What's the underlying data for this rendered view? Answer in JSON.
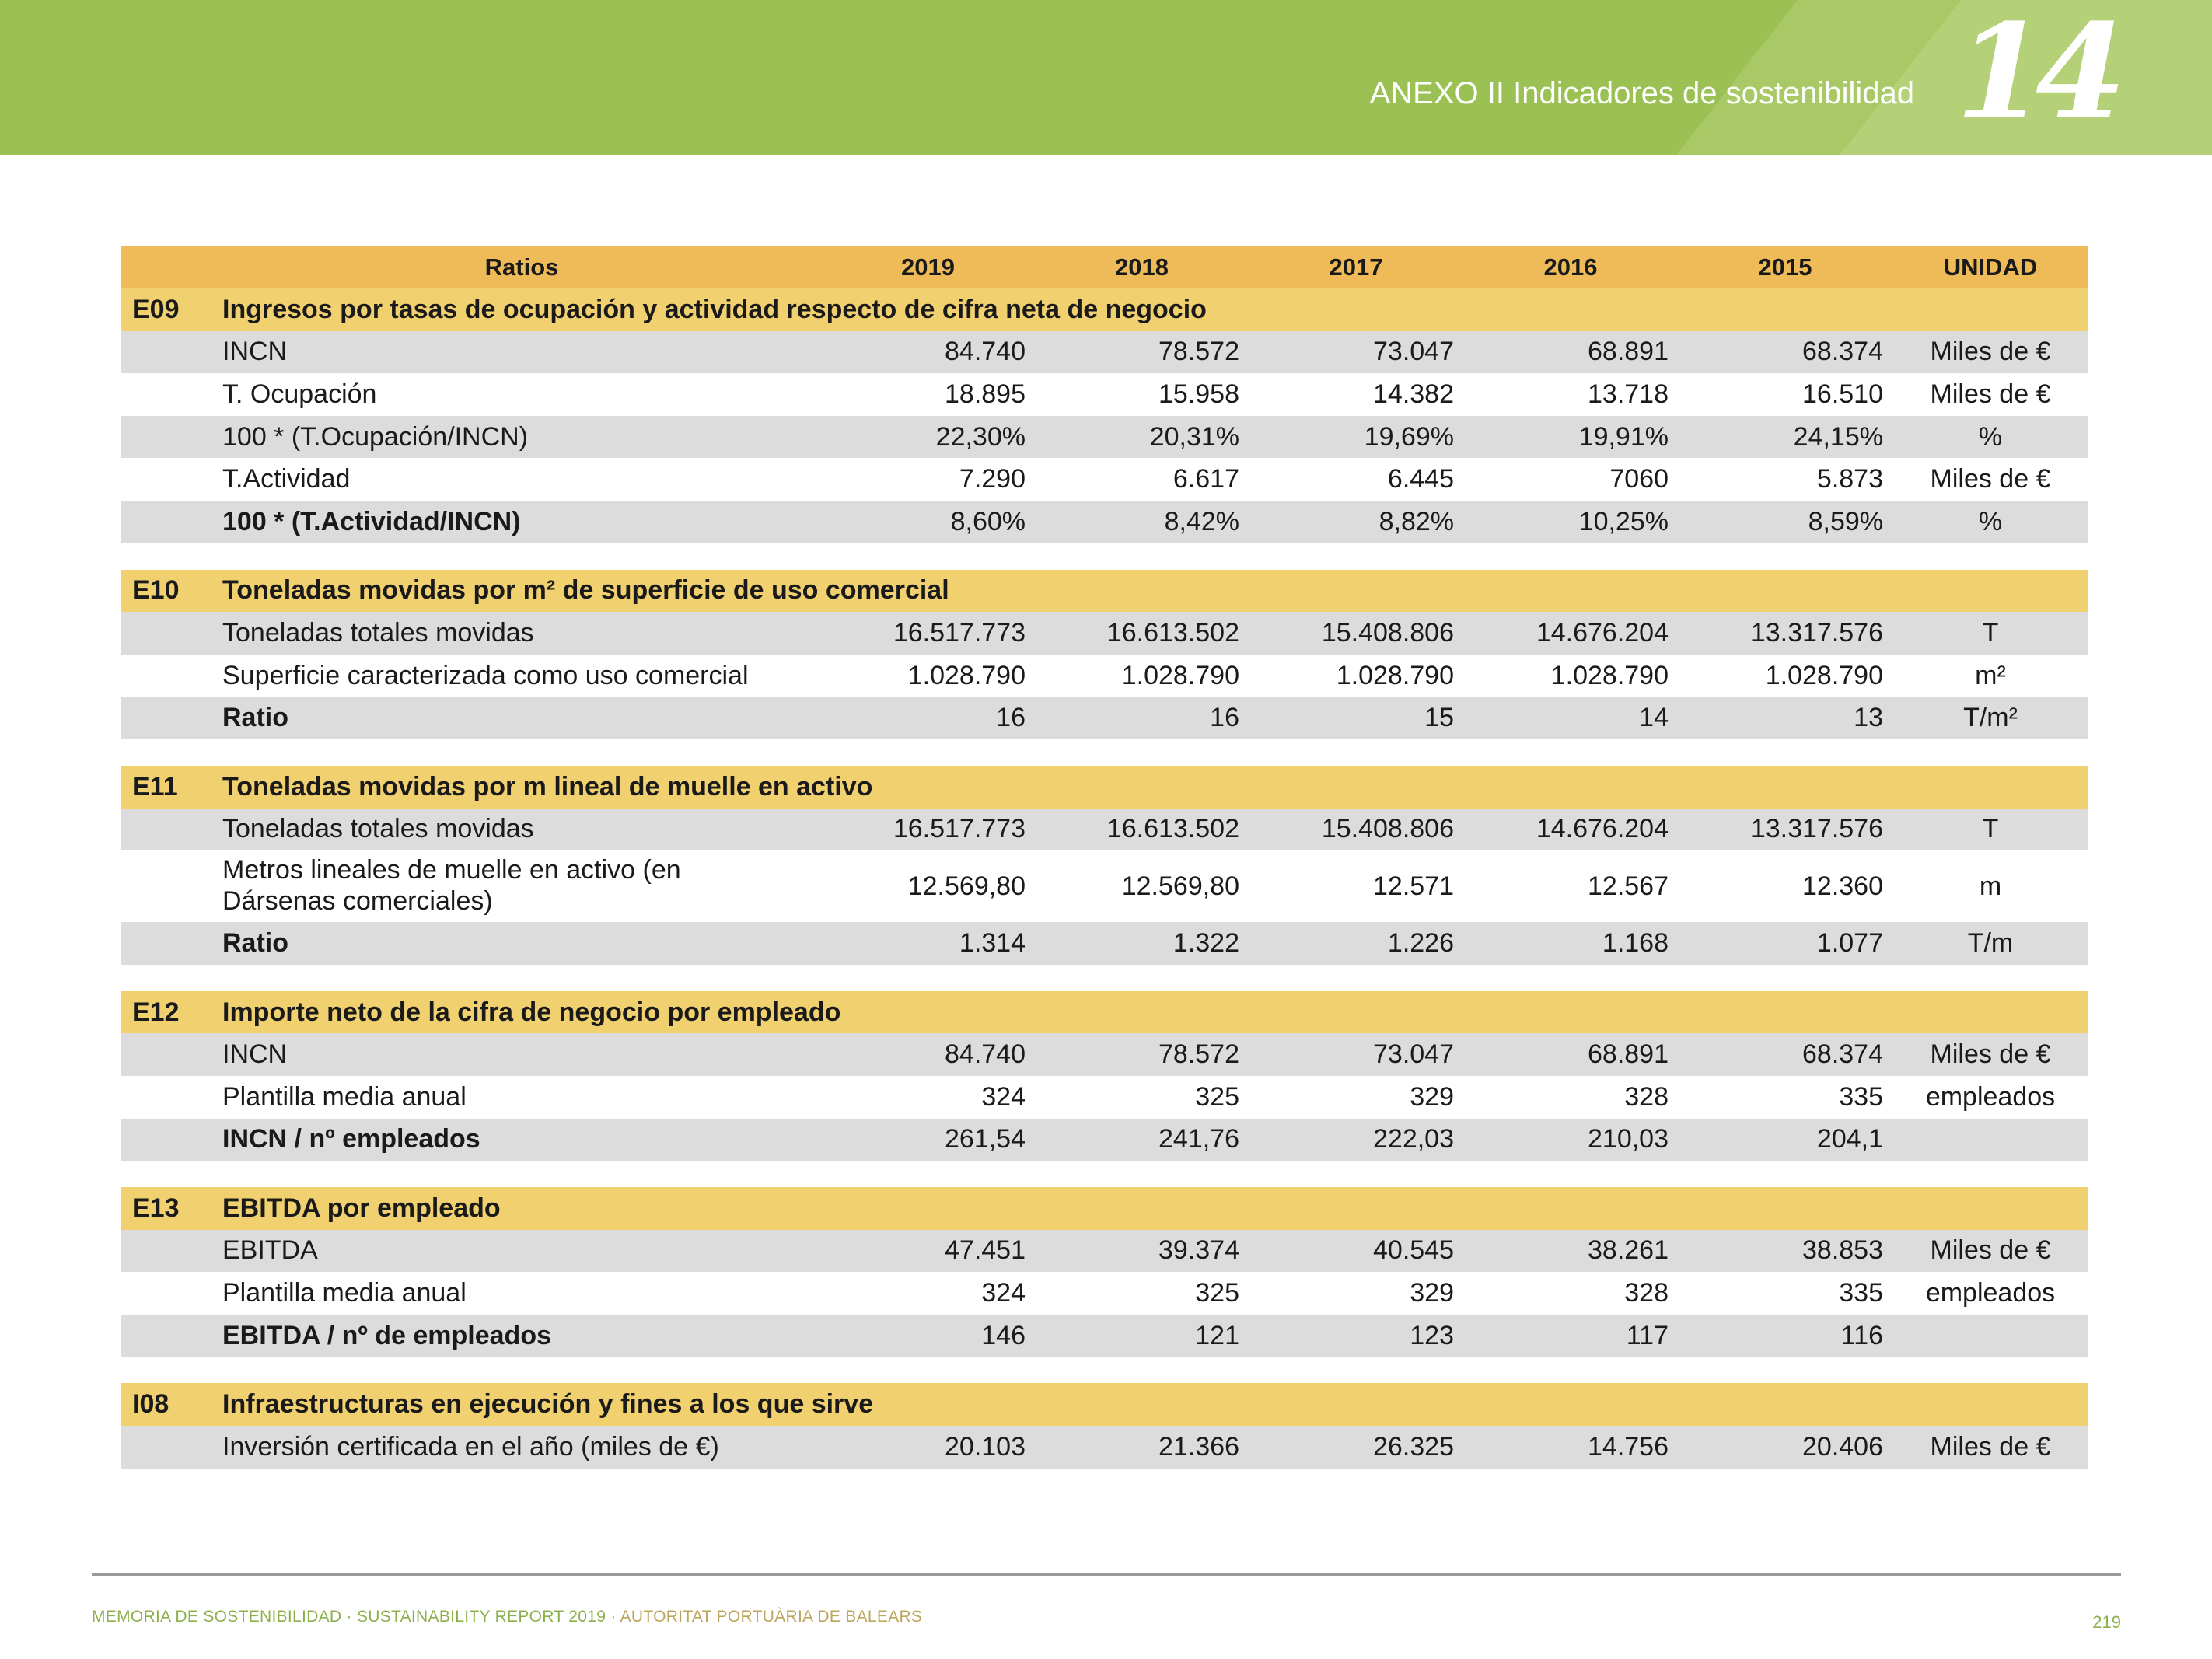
{
  "header": {
    "title": "ANEXO II Indicadores de sostenibilidad",
    "chapter_number": "14",
    "colors": {
      "band": "#9bc155",
      "text": "#ffffff"
    }
  },
  "table": {
    "columns": [
      "Ratios",
      "2019",
      "2018",
      "2017",
      "2016",
      "2015",
      "UNIDAD"
    ],
    "colors": {
      "column_header": "#eebb58",
      "section_header": "#f0d06f",
      "shaded_row": "#dcdcdc"
    },
    "sections": [
      {
        "code": "E09",
        "title": "Ingresos por tasas de ocupación y actividad respecto de cifra neta de negocio",
        "rows": [
          {
            "label": "INCN",
            "values": [
              "84.740",
              "78.572",
              "73.047",
              "68.891",
              "68.374"
            ],
            "unit": "Miles de €"
          },
          {
            "label": "T. Ocupación",
            "values": [
              "18.895",
              "15.958",
              "14.382",
              "13.718",
              "16.510"
            ],
            "unit": "Miles de €"
          },
          {
            "label": "100 * (T.Ocupación/INCN)",
            "values": [
              "22,30%",
              "20,31%",
              "19,69%",
              "19,91%",
              "24,15%"
            ],
            "unit": "%"
          },
          {
            "label": "T.Actividad",
            "values": [
              "7.290",
              "6.617",
              "6.445",
              "7060",
              "5.873"
            ],
            "unit": "Miles de €"
          },
          {
            "label": "100 * (T.Actividad/INCN)",
            "values": [
              "8,60%",
              "8,42%",
              "8,82%",
              "10,25%",
              "8,59%"
            ],
            "unit": "%"
          }
        ]
      },
      {
        "code": "E10",
        "title": "Toneladas movidas por m² de superficie de uso comercial",
        "rows": [
          {
            "label": "Toneladas totales movidas",
            "values": [
              "16.517.773",
              "16.613.502",
              "15.408.806",
              "14.676.204",
              "13.317.576"
            ],
            "unit": "T"
          },
          {
            "label": "Superficie caracterizada como uso comercial",
            "values": [
              "1.028.790",
              "1.028.790",
              "1.028.790",
              "1.028.790",
              "1.028.790"
            ],
            "unit": "m²"
          },
          {
            "label": "Ratio",
            "values": [
              "16",
              "16",
              "15",
              "14",
              "13"
            ],
            "unit": "T/m²"
          }
        ]
      },
      {
        "code": "E11",
        "title": "Toneladas movidas por m lineal de muelle en activo",
        "rows": [
          {
            "label": "Toneladas totales movidas",
            "values": [
              "16.517.773",
              "16.613.502",
              "15.408.806",
              "14.676.204",
              "13.317.576"
            ],
            "unit": "T"
          },
          {
            "label": "Metros lineales de muelle en activo (en Dársenas comerciales)",
            "values": [
              "12.569,80",
              "12.569,80",
              "12.571",
              "12.567",
              "12.360"
            ],
            "unit": "m"
          },
          {
            "label": "Ratio",
            "values": [
              "1.314",
              "1.322",
              "1.226",
              "1.168",
              "1.077"
            ],
            "unit": "T/m"
          }
        ]
      },
      {
        "code": "E12",
        "title": "Importe neto de la cifra de negocio por empleado",
        "rows": [
          {
            "label": "INCN",
            "values": [
              "84.740",
              "78.572",
              "73.047",
              "68.891",
              "68.374"
            ],
            "unit": "Miles de €"
          },
          {
            "label": "Plantilla media anual",
            "values": [
              "324",
              "325",
              "329",
              "328",
              "335"
            ],
            "unit": "empleados"
          },
          {
            "label": "INCN / nº empleados",
            "values": [
              "261,54",
              "241,76",
              "222,03",
              "210,03",
              "204,1"
            ],
            "unit": ""
          }
        ]
      },
      {
        "code": "E13",
        "title": "EBITDA por empleado",
        "rows": [
          {
            "label": "EBITDA",
            "values": [
              "47.451",
              "39.374",
              "40.545",
              "38.261",
              "38.853"
            ],
            "unit": "Miles de €"
          },
          {
            "label": "Plantilla media anual",
            "values": [
              "324",
              "325",
              "329",
              "328",
              "335"
            ],
            "unit": "empleados"
          },
          {
            "label": "EBITDA / nº de empleados",
            "values": [
              "146",
              "121",
              "123",
              "117",
              "116"
            ],
            "unit": ""
          }
        ]
      },
      {
        "code": "I08",
        "title": "Infraestructuras en ejecución y fines a los que sirve",
        "rows": [
          {
            "label": "Inversión certificada en el año (miles de €)",
            "values": [
              "20.103",
              "21.366",
              "26.325",
              "14.756",
              "20.406"
            ],
            "unit": "Miles de €"
          }
        ]
      }
    ]
  },
  "footer": {
    "part1": "MEMORIA DE SOSTENIBILIDAD",
    "sep1": " · ",
    "part2": "SUSTAINABILITY REPORT 2019",
    "sep2": " · ",
    "part3": "AUTORITAT PORTUÀRIA DE BALEARS",
    "page_number": "219"
  }
}
